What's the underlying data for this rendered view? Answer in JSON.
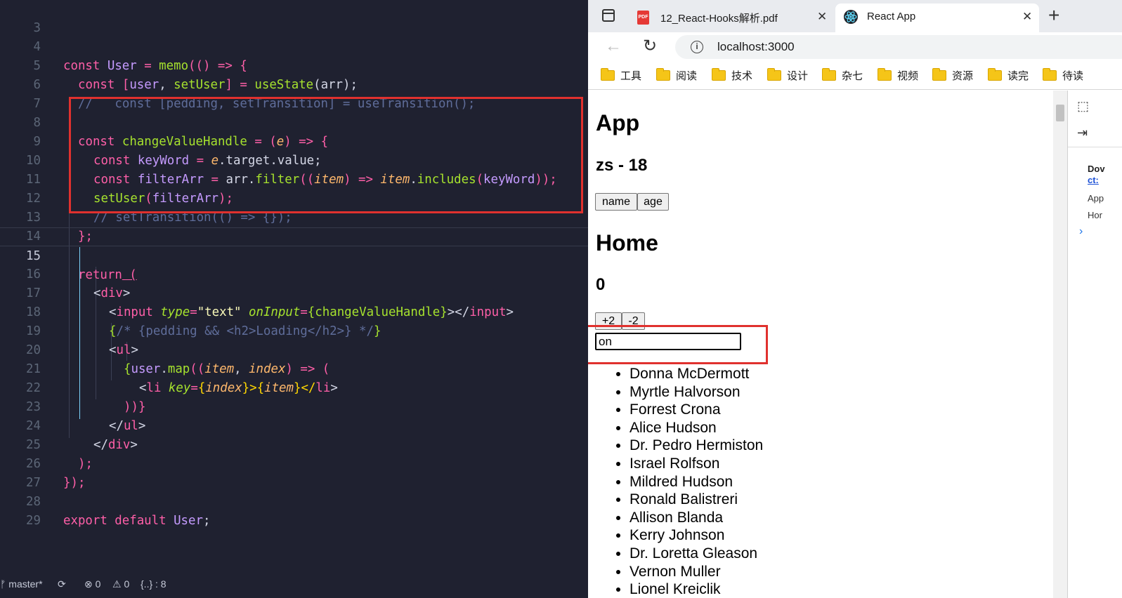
{
  "editor": {
    "line_numbers": [
      "3",
      "4",
      "5",
      "6",
      "7",
      "8",
      "9",
      "10",
      "11",
      "12",
      "13",
      "14",
      "15",
      "16",
      "17",
      "18",
      "19",
      "20",
      "21",
      "22",
      "23",
      "24",
      "25",
      "26",
      "27",
      "28",
      "29"
    ],
    "code": {
      "l4_const": "const",
      "l4_name": "User",
      "l4_eq": " = ",
      "l4_memo": "memo",
      "l4_rest": "(() => {",
      "l5_const": "const",
      "l5_destr_open": "[",
      "l5_user": "user",
      "l5_comma": ", ",
      "l5_setuser": "setUser",
      "l5_destr_close": "]",
      "l5_eq": " = ",
      "l5_usestate": "useState",
      "l5_args": "(arr);",
      "l6_comment": "//   const [pedding, setTransition] = useTransition();",
      "l8_const": "const",
      "l8_name": "changeValueHandle",
      "l8_eq": " = ",
      "l8_lp": "(",
      "l8_param": "e",
      "l8_rp": ") => {",
      "l9_const": "const",
      "l9_name": "keyWord",
      "l9_eq": " = ",
      "l9_e": "e",
      "l9_rest": ".target.value;",
      "l10_const": "const",
      "l10_name": "filterArr",
      "l10_eq": " = ",
      "l10_arr": "arr.",
      "l10_filter": "filter",
      "l10_lp": "((",
      "l10_item": "item",
      "l10_arrow": ") => ",
      "l10_item2": "item",
      "l10_dot": ".",
      "l10_includes": "includes",
      "l10_lp2": "(",
      "l10_kw": "keyWord",
      "l10_end": "));",
      "l11_setuser": "setUser",
      "l11_lp": "(",
      "l11_arg": "filterArr",
      "l11_end": ");",
      "l12_comment": "// setTransition(() => {});",
      "l13_close": "};",
      "l15_return": "return",
      "l15_paren": " (",
      "l16_open": "<",
      "l16_tag": "div",
      "l16_close": ">",
      "l17_open": "<",
      "l17_tag": "input",
      "l17_attr1": "type",
      "l17_eq1": "=",
      "l17_val1": "\"text\"",
      "l17_attr2": "onInput",
      "l17_eq2": "=",
      "l17_lb": "{",
      "l17_handler": "changeValueHandle",
      "l17_rb": "}",
      "l17_mid": "></",
      "l17_tag2": "input",
      "l17_end": ">",
      "l18_lb": "{",
      "l18_comment": "/* {pedding && <h2>Loading</h2>} */",
      "l18_rb": "}",
      "l19_open": "<",
      "l19_tag": "ul",
      "l19_close": ">",
      "l20_lb": "{",
      "l20_user": "user",
      "l20_dot": ".",
      "l20_map": "map",
      "l20_lp": "((",
      "l20_item": "item",
      "l20_comma": ", ",
      "l20_index": "index",
      "l20_arrow": ") => (",
      "l21_open": "<",
      "l21_tag": "li",
      "l21_attr": "key",
      "l21_eq": "=",
      "l21_lb": "{",
      "l21_index": "index",
      "l21_rb": "}>{",
      "l21_item": "item",
      "l21_rb2": "}</",
      "l21_tag2": "li",
      "l21_end": ">",
      "l22_close": "))}",
      "l23_open": "</",
      "l23_tag": "ul",
      "l23_close": ">",
      "l24_open": "</",
      "l24_tag": "div",
      "l24_close": ">",
      "l25_close": ");",
      "l26_close": "});",
      "l28_export": "export default",
      "l28_name": "User",
      "l28_semi": ";"
    },
    "status": {
      "branch": "master*",
      "errors": "⊗ 0",
      "warnings": "⚠ 0",
      "json": "{..} : 8"
    }
  },
  "browser": {
    "tabs": [
      {
        "title": "12_React-Hooks解析.pdf",
        "close": "✕"
      },
      {
        "title": "React App",
        "close": "✕"
      }
    ],
    "new_tab": "+",
    "address": "localhost:3000",
    "address_prefix_icon": "info-icon",
    "bookmarks": [
      "工具",
      "阅读",
      "技术",
      "设计",
      "杂七",
      "视频",
      "资源",
      "读完",
      "待读"
    ],
    "page": {
      "app_title": "App",
      "user_info": "zs - 18",
      "buttons": [
        "name",
        "age"
      ],
      "home_title": "Home",
      "count": "0",
      "count_buttons": [
        "+2",
        "-2"
      ],
      "input_value": "on",
      "users": [
        "Donna McDermott",
        "Myrtle Halvorson",
        "Forrest Crona",
        "Alice Hudson",
        "Dr. Pedro Hermiston",
        "Israel Rolfson",
        "Mildred Hudson",
        "Ronald Balistreri",
        "Allison Blanda",
        "Kerry Johnson",
        "Dr. Loretta Gleason",
        "Vernon Muller",
        "Lionel Kreiclik"
      ]
    },
    "devtools": {
      "lines": [
        "Dov",
        "ct:",
        "App",
        "Hor",
        "›"
      ]
    }
  },
  "colors": {
    "highlight": "#e0312e",
    "editor_bg": "#1f2130",
    "keyword": "#ff5fa8",
    "function": "#a6e22e",
    "variable": "#c59bff",
    "param": "#ffb86c",
    "comment": "#5f6d9a"
  }
}
